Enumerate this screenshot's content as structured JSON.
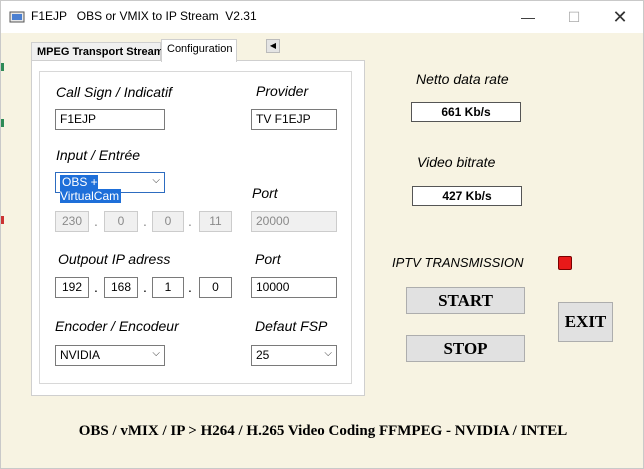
{
  "window": {
    "title": "F1EJP   OBS or VMIX to IP Stream  V2.31",
    "controls": {
      "minimize": "—",
      "maximize": "☐",
      "close": "✕"
    }
  },
  "tabs": [
    {
      "label": "MPEG Transport Stream",
      "active": false
    },
    {
      "label": "Configuration",
      "active": true
    }
  ],
  "tab_scroll_icon": "◀",
  "config": {
    "callsign_label": "Call Sign / Indicatif",
    "callsign_value": "F1EJP",
    "provider_label": "Provider",
    "provider_value": "TV F1EJP",
    "input_label": "Input / Entrée",
    "input_value": "OBS + VirtualCam",
    "input_port_label": "Port",
    "input_ip": [
      "230",
      "0",
      "0",
      "11"
    ],
    "input_port_value": "20000",
    "output_label": "Outpout IP adress",
    "output_port_label": "Port",
    "output_ip": [
      "192",
      "168",
      "1",
      "0"
    ],
    "output_port_value": "10000",
    "encoder_label": "Encoder / Encodeur",
    "encoder_value": "NVIDIA",
    "fps_label": "Defaut FSP",
    "fps_value": "25",
    "ip_separator": "."
  },
  "rates": {
    "net_label": "Netto data rate",
    "net_value": "661 Kb/s",
    "video_label": "Video bitrate",
    "video_value": "427 Kb/s"
  },
  "transmission": {
    "label": "IPTV TRANSMISSION",
    "indicator_color": "#e81919"
  },
  "buttons": {
    "start": "START",
    "stop": "STOP",
    "exit": "EXIT"
  },
  "footer": "OBS / vMIX / IP  >  H264 / H.265 Video Coding FFMPEG - NVIDIA / INTEL"
}
